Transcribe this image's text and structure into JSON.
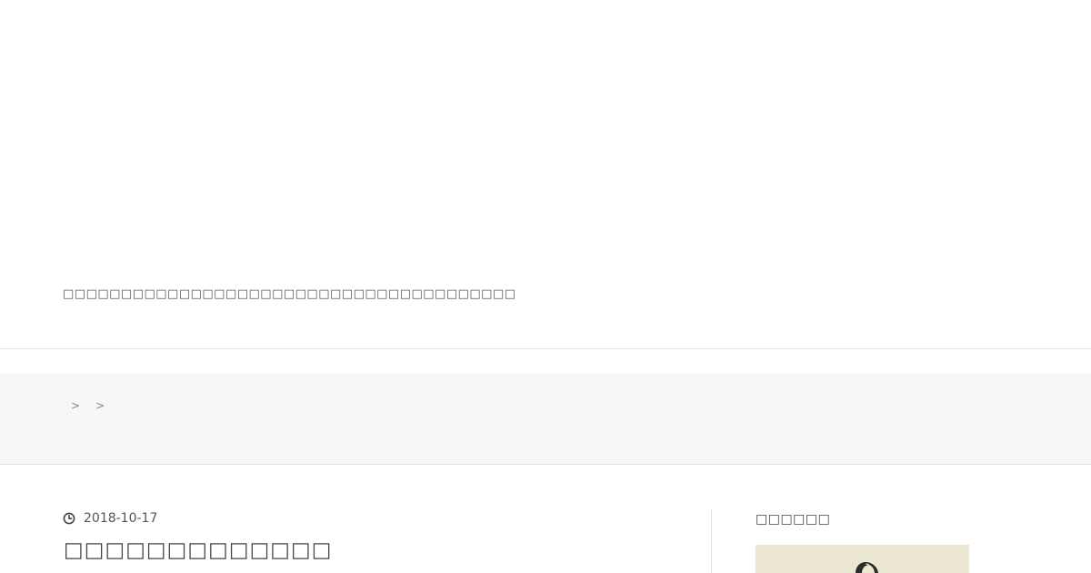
{
  "header": {
    "site_description": "□□□□□□□□□□□□□□□□□□□□□□□□□□□□□□□□□□□□□□□"
  },
  "breadcrumb": {
    "separators": [
      ">",
      ">"
    ]
  },
  "post": {
    "date": "2018-10-17",
    "title": "□□□□□□□□□□□□□"
  },
  "sidebar": {
    "widget_title": "□□□□□□"
  },
  "icons": {
    "date_icon": "clock-icon",
    "profile_illustration": "profile-image"
  },
  "colors": {
    "background": "#ffffff",
    "breadcrumb_background": "#f7f7f7",
    "text": "#444444",
    "divider": "#e3e3e3",
    "profile_background": "#ebe7d3"
  }
}
